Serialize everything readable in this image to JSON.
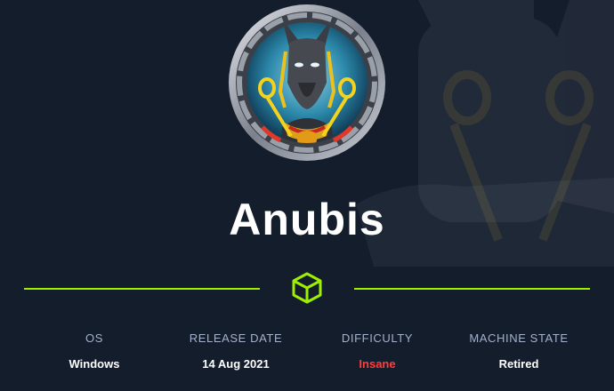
{
  "machine": {
    "name": "Anubis"
  },
  "stats": [
    {
      "label": "OS",
      "value": "Windows"
    },
    {
      "label": "RELEASE DATE",
      "value": "14 Aug 2021"
    },
    {
      "label": "DIFFICULTY",
      "value": "Insane"
    },
    {
      "label": "MACHINE STATE",
      "value": "Retired"
    }
  ],
  "colors": {
    "background": "#141d2b",
    "accent": "#9fef00",
    "label": "#a4b1cd",
    "difficulty_insane": "#ff3e3e"
  },
  "icons": {
    "divider": "cube-icon",
    "avatar": "anubis-avatar"
  }
}
